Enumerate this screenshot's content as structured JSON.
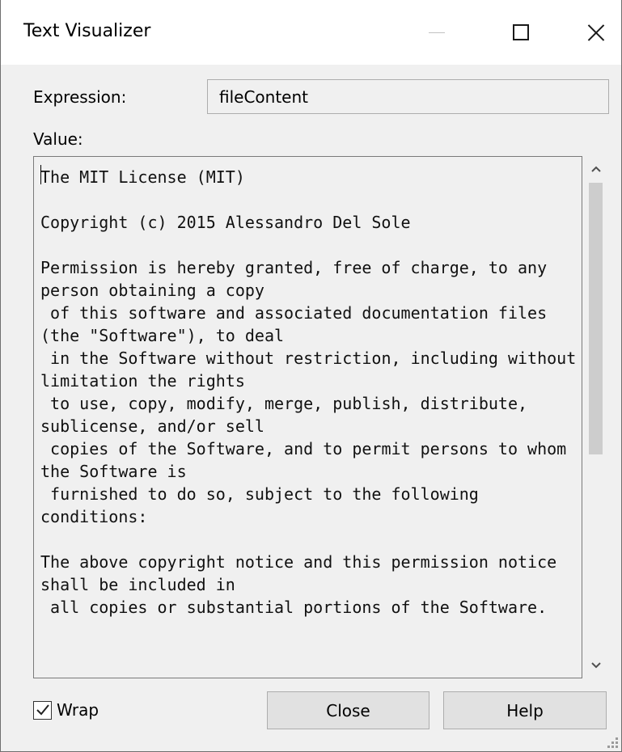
{
  "window": {
    "title": "Text Visualizer"
  },
  "expression": {
    "label": "Expression:",
    "value": "fileContent"
  },
  "value": {
    "label": "Value:",
    "text": "The MIT License (MIT)\n\nCopyright (c) 2015 Alessandro Del Sole\n\nPermission is hereby granted, free of charge, to any person obtaining a copy\n of this software and associated documentation files (the \"Software\"), to deal\n in the Software without restriction, including without limitation the rights\n to use, copy, modify, merge, publish, distribute, sublicense, and/or sell\n copies of the Software, and to permit persons to whom the Software is\n furnished to do so, subject to the following conditions:\n\nThe above copyright notice and this permission notice shall be included in\n all copies or substantial portions of the Software."
  },
  "wrap": {
    "label": "Wrap",
    "checked": true
  },
  "buttons": {
    "close": "Close",
    "help": "Help"
  },
  "icons": {
    "minimize": "minimize-icon",
    "maximize": "maximize-icon",
    "close": "close-icon",
    "scroll_up": "chevron-up-icon",
    "scroll_down": "chevron-down-icon",
    "checkmark": "checkmark-icon",
    "resize_grip": "resize-grip-icon"
  }
}
